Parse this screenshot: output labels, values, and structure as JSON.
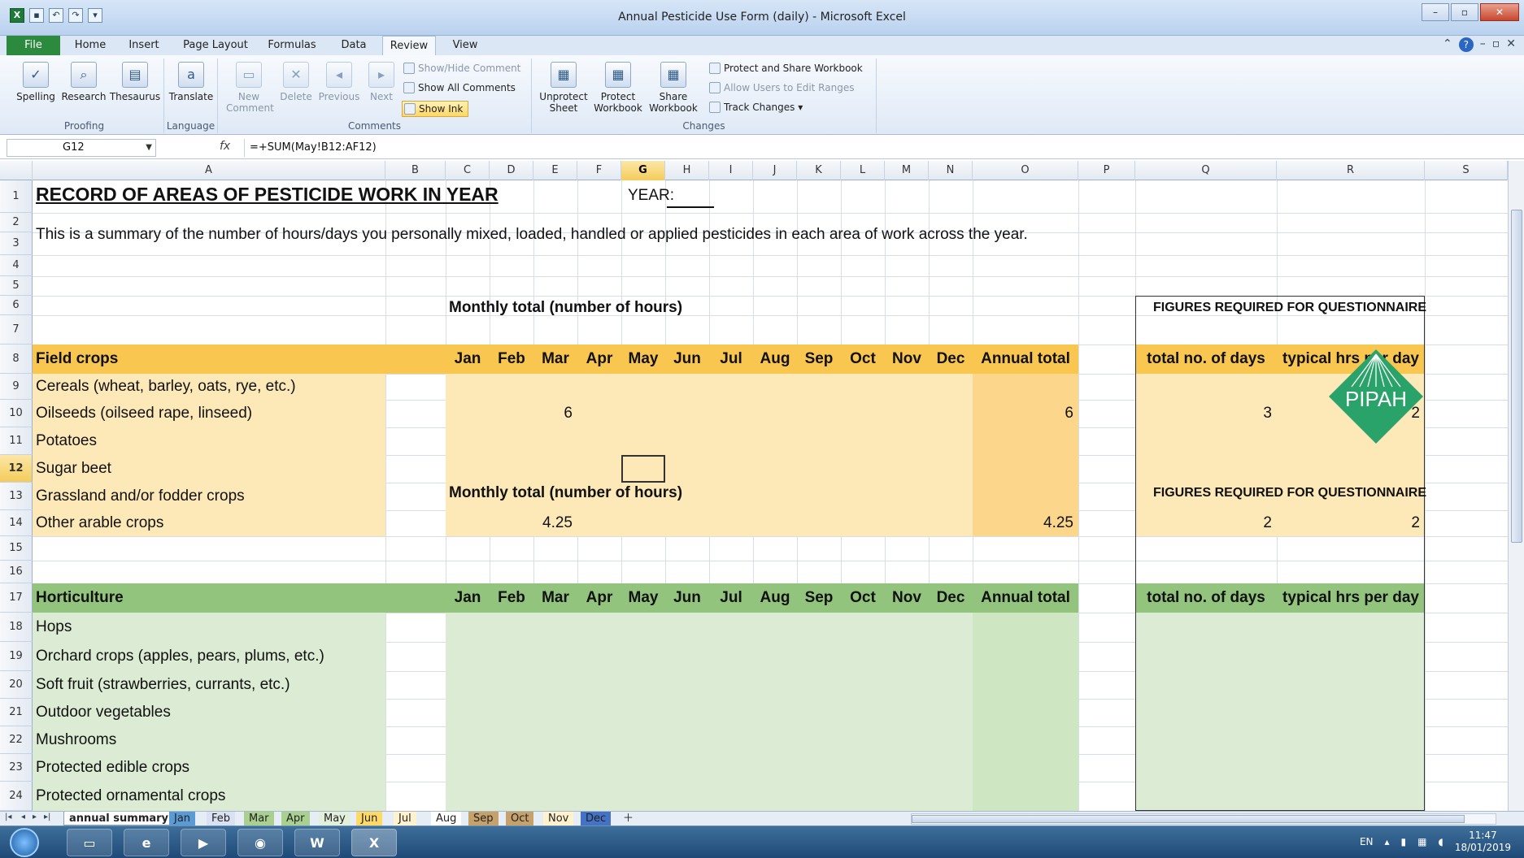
{
  "window": {
    "title": "Annual Pesticide Use Form (daily)  -  Microsoft Excel",
    "controls": [
      "–",
      "▫",
      "✕"
    ]
  },
  "ribbon_tabs": [
    "File",
    "Home",
    "Insert",
    "Page Layout",
    "Formulas",
    "Data",
    "Review",
    "View"
  ],
  "active_tab": "Review",
  "ribbon": {
    "groups": {
      "proofing": "Proofing",
      "language": "Language",
      "comments": "Comments",
      "changes": "Changes"
    },
    "buttons": {
      "spelling": "Spelling",
      "research": "Research",
      "thesaurus": "Thesaurus",
      "translate": "Translate",
      "new_comment": "New Comment",
      "delete": "Delete",
      "previous": "Previous",
      "next": "Next",
      "show_hide_comment": "Show/Hide Comment",
      "show_all_comments": "Show All Comments",
      "show_ink": "Show Ink",
      "unprotect_sheet": "Unprotect Sheet",
      "protect_workbook": "Protect Workbook",
      "share_workbook": "Share Workbook",
      "protect_share_workbook": "Protect and Share Workbook",
      "allow_users_edit_ranges": "Allow Users to Edit Ranges",
      "track_changes": "Track Changes ▾"
    }
  },
  "formula_bar": {
    "name_box": "G12",
    "fx": "fx",
    "formula": "=+SUM(May!B12:AF12)"
  },
  "columns": [
    "A",
    "B",
    "C",
    "D",
    "E",
    "F",
    "G",
    "H",
    "I",
    "J",
    "K",
    "L",
    "M",
    "N",
    "O",
    "P",
    "Q",
    "R",
    "S"
  ],
  "rows": [
    "1",
    "2",
    "3",
    "4",
    "5",
    "6",
    "7",
    "8",
    "9",
    "10",
    "11",
    "12",
    "13",
    "14",
    "15",
    "16",
    "17",
    "18",
    "19",
    "20",
    "21",
    "22",
    "23",
    "24"
  ],
  "sheet": {
    "title": "RECORD OF AREAS OF PESTICIDE WORK IN YEAR",
    "year_label": "YEAR:",
    "intro": "This is a summary of the number of hours/days you personally mixed, loaded, handled or applied pesticides in each area of work across the year.",
    "monthly_total_label": "Monthly total (number of hours)",
    "figures_required_label": "FIGURES REQUIRED FOR QUESTIONNAIRE",
    "months": [
      "Jan",
      "Feb",
      "Mar",
      "Apr",
      "May",
      "Jun",
      "Jul",
      "Aug",
      "Sep",
      "Oct",
      "Nov",
      "Dec"
    ],
    "annual_total_label": "Annual total",
    "total_days_label": "total no. of days",
    "typical_hrs_label": "typical hrs per day",
    "logo_text": "PIPAH",
    "field_crops": {
      "heading": "Field crops",
      "rows": [
        {
          "name": "Cereals (wheat, barley, oats, rye, etc.)",
          "mar": "",
          "annual": "",
          "days": "",
          "hrs": ""
        },
        {
          "name": "Oilseeds (oilseed rape, linseed)",
          "mar": "6",
          "annual": "6",
          "days": "3",
          "hrs": "2"
        },
        {
          "name": "Potatoes",
          "mar": "",
          "annual": "",
          "days": "",
          "hrs": ""
        },
        {
          "name": "Sugar beet",
          "mar": "",
          "annual": "",
          "days": "",
          "hrs": ""
        },
        {
          "name": "Grassland and/or fodder crops",
          "mar": "",
          "annual": "",
          "days": "",
          "hrs": ""
        },
        {
          "name": "Other arable crops",
          "mar": "4.25",
          "annual": "4.25",
          "days": "2",
          "hrs": "2"
        }
      ]
    },
    "horticulture": {
      "heading": "Horticulture",
      "rows": [
        {
          "name": "Hops"
        },
        {
          "name": "Orchard crops (apples, pears, plums, etc.)"
        },
        {
          "name": "Soft fruit (strawberries, currants, etc.)"
        },
        {
          "name": "Outdoor vegetables"
        },
        {
          "name": "Mushrooms"
        },
        {
          "name": "Protected edible crops"
        },
        {
          "name": "Protected ornamental crops"
        }
      ]
    }
  },
  "sheet_tabs": [
    "annual summary",
    "Jan",
    "Feb",
    "Mar",
    "Apr",
    "May",
    "Jun",
    "Jul",
    "Aug",
    "Sep",
    "Oct",
    "Nov",
    "Dec"
  ],
  "active_sheet": "annual summary",
  "taskbar": {
    "apps": [
      "Explorer",
      "Internet Explorer",
      "Media Player",
      "Chrome",
      "Word",
      "Excel"
    ],
    "lang": "EN",
    "time": "11:47",
    "date": "18/01/2019"
  },
  "colors": {
    "field_header": "#f9c64f",
    "field_fill": "#fde9b7",
    "hort_header": "#93c47d",
    "hort_fill": "#dcebd3",
    "selected_header": "#f5cc5a",
    "logo_green": "#2aa36b"
  }
}
